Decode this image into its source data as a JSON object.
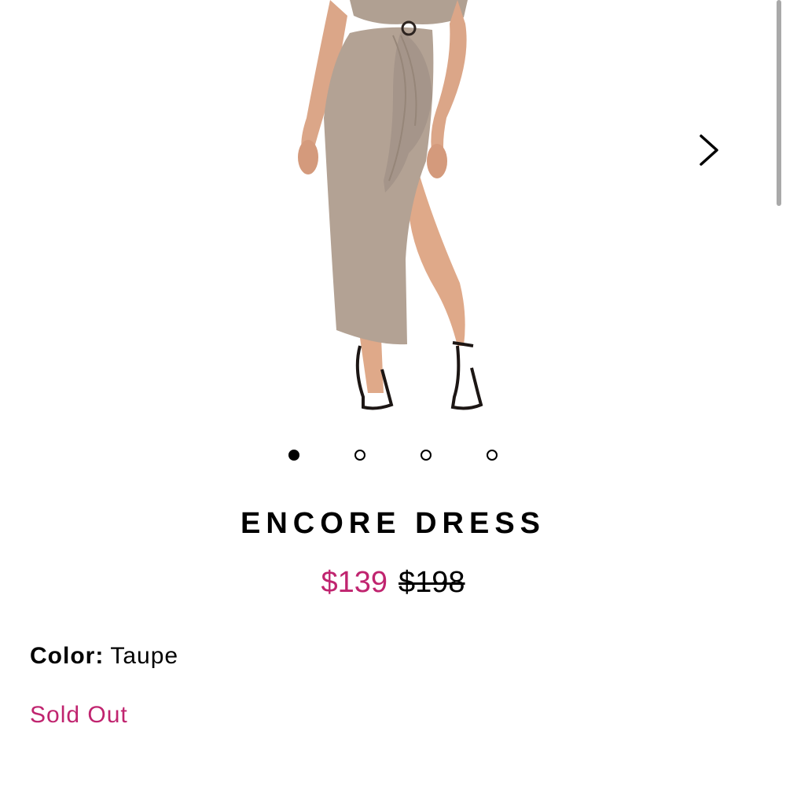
{
  "product": {
    "title": "ENCORE DRESS",
    "price_sale": "$139",
    "price_original": "$198",
    "color_label": "Color:",
    "color_value": "Taupe",
    "stock_status": "Sold Out"
  },
  "carousel": {
    "slide_count": 4,
    "active_index": 0,
    "next_icon": "chevron-right-icon"
  },
  "colors": {
    "sale": "#c0246f",
    "dress": "#b3a294",
    "skin": "#e0ac8c"
  }
}
